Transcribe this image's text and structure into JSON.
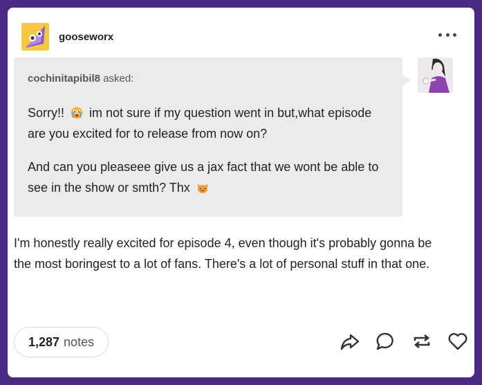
{
  "post": {
    "blog_name": "gooseworx",
    "ask": {
      "asker": "cochinitapibil8",
      "asked_label": "asked:",
      "paragraph1_a": "Sorry!! ",
      "paragraph1_b": " im not sure if my question went in but,what episode are you excited for to release from now on?",
      "paragraph2_a": "And can you pleaseee give us a jax fact that we wont be able to see in the show or smth? Thx ",
      "emoji1": "crying-face-emoji",
      "emoji2": "cat-face-emoji"
    },
    "answer": "I'm honestly really excited for episode 4, even though it's probably gonna be the most boringest to a lot of fans. There's a lot of personal stuff in that one.",
    "notes_count": "1,287",
    "notes_label": "notes",
    "icons": [
      "share-icon",
      "reply-icon",
      "reblog-icon",
      "like-icon"
    ]
  },
  "colors": {
    "background": "#4a2a85",
    "card": "#ffffff",
    "ask_bubble": "#ebebeb"
  }
}
